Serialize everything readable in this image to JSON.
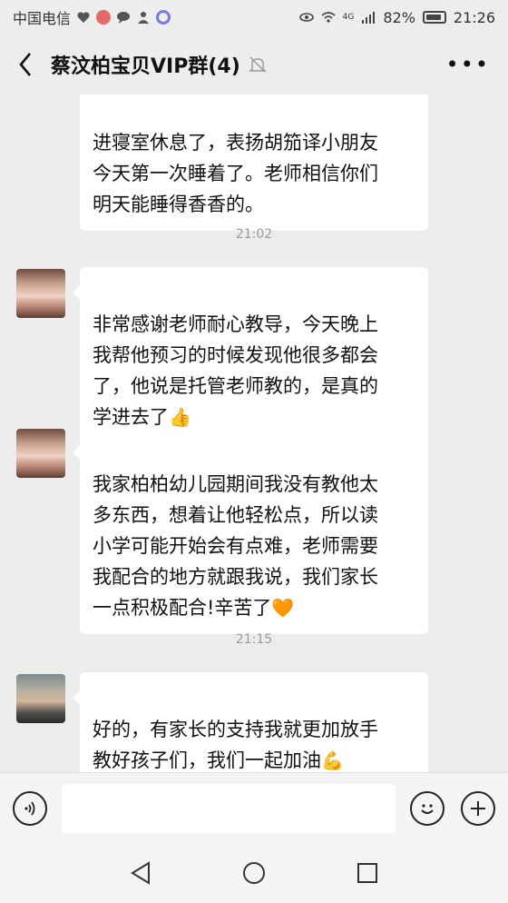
{
  "status_bar": {
    "carrier": "中国电信",
    "network": "4G",
    "battery": "82%",
    "time": "21:26",
    "icons": [
      "heart-icon",
      "app-icon",
      "chat-icon",
      "person-icon",
      "circle-app-icon",
      "eye-icon",
      "wifi-icon",
      "signal-icon",
      "battery-icon"
    ]
  },
  "header": {
    "title": "蔡汶柏宝贝VIP群(4)",
    "back_icon": "chevron-left-icon",
    "mute_icon": "bell-off-icon",
    "more_label": "•••"
  },
  "messages": [
    {
      "type": "text",
      "avatar": "none",
      "text": "进寝室休息了，表扬胡笳译小朋友\n今天第一次睡着了。老师相信你们\n明天能睡得香香的。"
    },
    {
      "type": "timestamp",
      "text": "21:02"
    },
    {
      "type": "text",
      "avatar": "face",
      "text": "非常感谢老师耐心教导，今天晚上\n我帮他预习的时候发现他很多都会\n了，他说是托管老师教的，是真的\n学进去了",
      "emoji": "👍"
    },
    {
      "type": "text",
      "avatar": "face",
      "text": "我家柏柏幼儿园期间我没有教他太\n多东西，想着让他轻松点，所以读\n小学可能开始会有点难，老师需要\n我配合的地方就跟我说，我们家长\n一点积极配合!辛苦了",
      "emoji": "🧡"
    },
    {
      "type": "timestamp",
      "text": "21:15"
    },
    {
      "type": "text",
      "avatar": "sky",
      "text": "好的，有家长的支持我就更加放手\n教好孩子们，我们一起加油",
      "emoji": "💪"
    }
  ],
  "input_bar": {
    "voice_icon": "voice-icon",
    "emoji_icon": "smiley-icon",
    "plus_icon": "plus-icon",
    "input_value": ""
  },
  "nav_bar": {
    "icons": [
      "back-triangle-icon",
      "home-circle-icon",
      "recents-square-icon"
    ]
  },
  "colors": {
    "background": "#ececec",
    "bubble": "#ffffff",
    "timestamp": "#9a9a9a"
  }
}
